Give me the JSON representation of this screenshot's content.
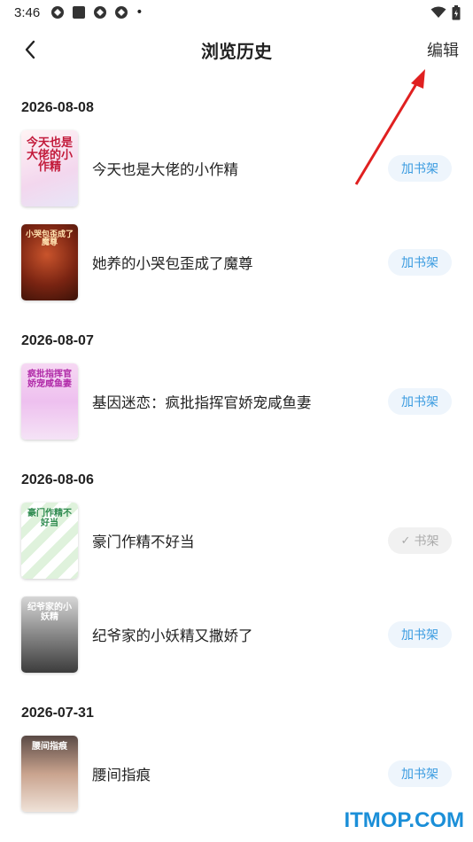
{
  "status": {
    "time": "3:46",
    "dot": "•"
  },
  "header": {
    "title": "浏览历史",
    "edit_label": "编辑"
  },
  "groups": [
    {
      "date": "2026-08-08",
      "items": [
        {
          "title": "今天也是大佬的小作精",
          "cover_text": "今天也是大佬的小作精",
          "button": "加书架",
          "added": false
        },
        {
          "title": "她养的小哭包歪成了魔尊",
          "cover_text": "小哭包歪成了魔尊",
          "button": "加书架",
          "added": false
        }
      ]
    },
    {
      "date": "2026-08-07",
      "items": [
        {
          "title": "基因迷恋：疯批指挥官娇宠咸鱼妻",
          "cover_text": "疯批指挥官娇宠咸鱼妻",
          "button": "加书架",
          "added": false
        }
      ]
    },
    {
      "date": "2026-08-06",
      "items": [
        {
          "title": "豪门作精不好当",
          "cover_text": "豪门作精不好当",
          "button": "书架",
          "added": true
        },
        {
          "title": "纪爷家的小妖精又撒娇了",
          "cover_text": "纪爷家的小妖精",
          "button": "加书架",
          "added": false
        }
      ]
    },
    {
      "date": "2026-07-31",
      "items": [
        {
          "title": "腰间指痕",
          "cover_text": "腰间指痕",
          "button": "加书架",
          "added": false
        }
      ]
    }
  ],
  "watermark": "ITMOP.COM",
  "colors": {
    "accent": "#3a9be0",
    "button_bg": "#eef5fc",
    "added_text": "#aaaaaa",
    "arrow": "#e02020",
    "watermark": "#1b8fd8"
  }
}
